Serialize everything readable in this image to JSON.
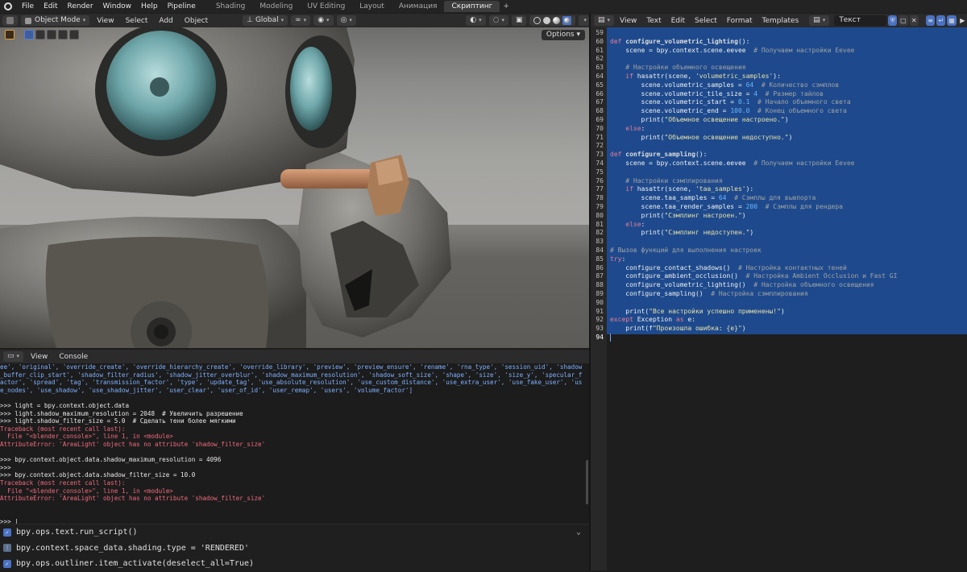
{
  "topbar": {
    "menus": [
      "File",
      "Edit",
      "Render",
      "Window",
      "Help",
      "Pipeline"
    ],
    "workspaces": [
      "Shading",
      "Modeling",
      "UV Editing",
      "Layout",
      "Анимация",
      "Скриптинг"
    ],
    "active_workspace": "Скриптинг",
    "add_tab": "+"
  },
  "viewport_header": {
    "mode": "Object Mode",
    "menus": [
      "View",
      "Select",
      "Add",
      "Object"
    ],
    "orientation": "Global",
    "options": "Options"
  },
  "text_editor_header": {
    "menus": [
      "View",
      "Text",
      "Edit",
      "Select",
      "Format",
      "Templates"
    ],
    "text_name": "Текст"
  },
  "code_lines": [
    {
      "n": "59",
      "s": []
    },
    {
      "n": "60",
      "s": [
        [
          "kw",
          "def "
        ],
        [
          "fn",
          "configure_volumetric_lighting"
        ],
        [
          "tx",
          "():"
        ]
      ]
    },
    {
      "n": "61",
      "s": [
        [
          "tx",
          "    scene = bpy.context.scene.eevee  "
        ],
        [
          "cm",
          "# Получаем настройки Eevee"
        ]
      ]
    },
    {
      "n": "62",
      "s": []
    },
    {
      "n": "63",
      "s": [
        [
          "cm",
          "    # Настройки объемного освещения"
        ]
      ]
    },
    {
      "n": "64",
      "s": [
        [
          "kw",
          "    if "
        ],
        [
          "tx",
          "hasattr(scene, "
        ],
        [
          "st",
          "'volumetric_samples'"
        ],
        [
          "tx",
          "):"
        ]
      ]
    },
    {
      "n": "65",
      "s": [
        [
          "tx",
          "        scene.volumetric_samples = "
        ],
        [
          "nb",
          "64"
        ],
        [
          "cm",
          "  # Количество сэмплов"
        ]
      ]
    },
    {
      "n": "66",
      "s": [
        [
          "tx",
          "        scene.volumetric_tile_size = "
        ],
        [
          "nb",
          "4"
        ],
        [
          "cm",
          "  # Размер тайлов"
        ]
      ]
    },
    {
      "n": "67",
      "s": [
        [
          "tx",
          "        scene.volumetric_start = "
        ],
        [
          "nb",
          "0.1"
        ],
        [
          "cm",
          "  # Начало объемного света"
        ]
      ]
    },
    {
      "n": "68",
      "s": [
        [
          "tx",
          "        scene.volumetric_end = "
        ],
        [
          "nb",
          "100.0"
        ],
        [
          "cm",
          "  # Конец объемного света"
        ]
      ]
    },
    {
      "n": "69",
      "s": [
        [
          "tx",
          "        print("
        ],
        [
          "st",
          "\"Объемное освещение настроено.\""
        ],
        [
          "tx",
          ")"
        ]
      ]
    },
    {
      "n": "70",
      "s": [
        [
          "kw",
          "    else"
        ],
        [
          "tx",
          ":"
        ]
      ]
    },
    {
      "n": "71",
      "s": [
        [
          "tx",
          "        print("
        ],
        [
          "st",
          "\"Объемное освещение недоступно.\""
        ],
        [
          "tx",
          ")"
        ]
      ]
    },
    {
      "n": "72",
      "s": []
    },
    {
      "n": "73",
      "s": [
        [
          "kw",
          "def "
        ],
        [
          "fn",
          "configure_sampling"
        ],
        [
          "tx",
          "():"
        ]
      ]
    },
    {
      "n": "74",
      "s": [
        [
          "tx",
          "    scene = bpy.context.scene.eevee  "
        ],
        [
          "cm",
          "# Получаем настройки Eevee"
        ]
      ]
    },
    {
      "n": "75",
      "s": []
    },
    {
      "n": "76",
      "s": [
        [
          "cm",
          "    # Настройки сэмплирования"
        ]
      ]
    },
    {
      "n": "77",
      "s": [
        [
          "kw",
          "    if "
        ],
        [
          "tx",
          "hasattr(scene, "
        ],
        [
          "st",
          "'taa_samples'"
        ],
        [
          "tx",
          "):"
        ]
      ]
    },
    {
      "n": "78",
      "s": [
        [
          "tx",
          "        scene.taa_samples = "
        ],
        [
          "nb",
          "64"
        ],
        [
          "cm",
          "  # Сэмплы для вьюпорта"
        ]
      ]
    },
    {
      "n": "79",
      "s": [
        [
          "tx",
          "        scene.taa_render_samples = "
        ],
        [
          "nb",
          "200"
        ],
        [
          "cm",
          "  # Сэмплы для рендера"
        ]
      ]
    },
    {
      "n": "80",
      "s": [
        [
          "tx",
          "        print("
        ],
        [
          "st",
          "\"Сэмплинг настроен.\""
        ],
        [
          "tx",
          ")"
        ]
      ]
    },
    {
      "n": "81",
      "s": [
        [
          "kw",
          "    else"
        ],
        [
          "tx",
          ":"
        ]
      ]
    },
    {
      "n": "82",
      "s": [
        [
          "tx",
          "        print("
        ],
        [
          "st",
          "\"Сэмплинг недоступен.\""
        ],
        [
          "tx",
          ")"
        ]
      ]
    },
    {
      "n": "83",
      "s": []
    },
    {
      "n": "84",
      "s": [
        [
          "cm",
          "# Вызов функций для выполнения настроек"
        ]
      ]
    },
    {
      "n": "85",
      "s": [
        [
          "kw",
          "try"
        ],
        [
          "tx",
          ":"
        ]
      ]
    },
    {
      "n": "86",
      "s": [
        [
          "tx",
          "    configure_contact_shadows()  "
        ],
        [
          "cm",
          "# Настройка контактных теней"
        ]
      ]
    },
    {
      "n": "87",
      "s": [
        [
          "tx",
          "    configure_ambient_occlusion()  "
        ],
        [
          "cm",
          "# Настройка Ambient Occlusion и Fast GI"
        ]
      ]
    },
    {
      "n": "88",
      "s": [
        [
          "tx",
          "    configure_volumetric_lighting()  "
        ],
        [
          "cm",
          "# Настройка объемного освещения"
        ]
      ]
    },
    {
      "n": "89",
      "s": [
        [
          "tx",
          "    configure_sampling()  "
        ],
        [
          "cm",
          "# Настройка сэмплирования"
        ]
      ]
    },
    {
      "n": "90",
      "s": []
    },
    {
      "n": "91",
      "s": [
        [
          "tx",
          "    print("
        ],
        [
          "st",
          "\"Все настройки успешно применены!\""
        ],
        [
          "tx",
          ")"
        ]
      ]
    },
    {
      "n": "92",
      "s": [
        [
          "kw",
          "except "
        ],
        [
          "tx",
          "Exception "
        ],
        [
          "kw",
          "as "
        ],
        [
          "tx",
          "e:"
        ]
      ]
    },
    {
      "n": "93",
      "s": [
        [
          "tx",
          "    print(f"
        ],
        [
          "st",
          "\"Произошла ошибка: {e}\""
        ],
        [
          "tx",
          ")"
        ]
      ]
    },
    {
      "n": "94",
      "s": []
    }
  ],
  "console_header": {
    "menus": [
      "View",
      "Console"
    ]
  },
  "console_lines": [
    {
      "c": "blue",
      "t": "ee', 'original', 'override_create', 'override_hierarchy_create', 'override_library', 'preview', 'preview_ensure', 'rename', 'rna_type', 'session_uid', 'shadow"
    },
    {
      "c": "blue",
      "t": "_buffer_clip_start', 'shadow_filter_radius', 'shadow_jitter_overblur', 'shadow_maximum_resolution', 'shadow_soft_size', 'shape', 'size', 'size_y', 'specular_f"
    },
    {
      "c": "blue",
      "t": "actor', 'spread', 'tag', 'transmission_factor', 'type', 'update_tag', 'use_absolute_resolution', 'use_custom_distance', 'use_extra_user', 'use_fake_user', 'us"
    },
    {
      "c": "blue",
      "t": "e_nodes', 'use_shadow', 'use_shadow_jitter', 'user_clear', 'user_of_id', 'user_remap', 'users', 'volume_factor']"
    },
    {
      "c": "white",
      "t": ""
    },
    {
      "c": "white",
      "t": ">>> light = bpy.context.object.data"
    },
    {
      "c": "white",
      "t": ">>> light.shadow_maximum_resolution = 2048  # Увеличить разрешение"
    },
    {
      "c": "white",
      "t": ">>> light.shadow_filter_size = 5.0  # Сделать тени более мягкими"
    },
    {
      "c": "red",
      "t": "Traceback (most recent call last):"
    },
    {
      "c": "red",
      "t": "  File \"<blender_console>\", line 1, in <module>"
    },
    {
      "c": "red",
      "t": "AttributeError: 'AreaLight' object has no attribute 'shadow_filter_size'"
    },
    {
      "c": "white",
      "t": ""
    },
    {
      "c": "white",
      "t": ">>> bpy.context.object.data.shadow_maximum_resolution = 4096"
    },
    {
      "c": "white",
      "t": ">>>"
    },
    {
      "c": "white",
      "t": ">>> bpy.context.object.data.shadow_filter_size = 10.0"
    },
    {
      "c": "red",
      "t": "Traceback (most recent call last):"
    },
    {
      "c": "red",
      "t": "  File \"<blender_console>\", line 1, in <module>"
    },
    {
      "c": "red",
      "t": "AttributeError: 'AreaLight' object has no attribute 'shadow_filter_size'"
    },
    {
      "c": "white",
      "t": ""
    },
    {
      "c": "white",
      "t": ""
    },
    {
      "c": "white",
      "t": ">>> |"
    }
  ],
  "info_lines": [
    "bpy.ops.text.run_script()",
    "bpy.context.space_data.shading.type = 'RENDERED'",
    "bpy.ops.outliner.item_activate(deselect_all=True)"
  ],
  "colors": {
    "selection": "#1e4a8d",
    "accent": "#4a72c2",
    "error": "#f06a7c",
    "keyword": "#e87d96"
  }
}
